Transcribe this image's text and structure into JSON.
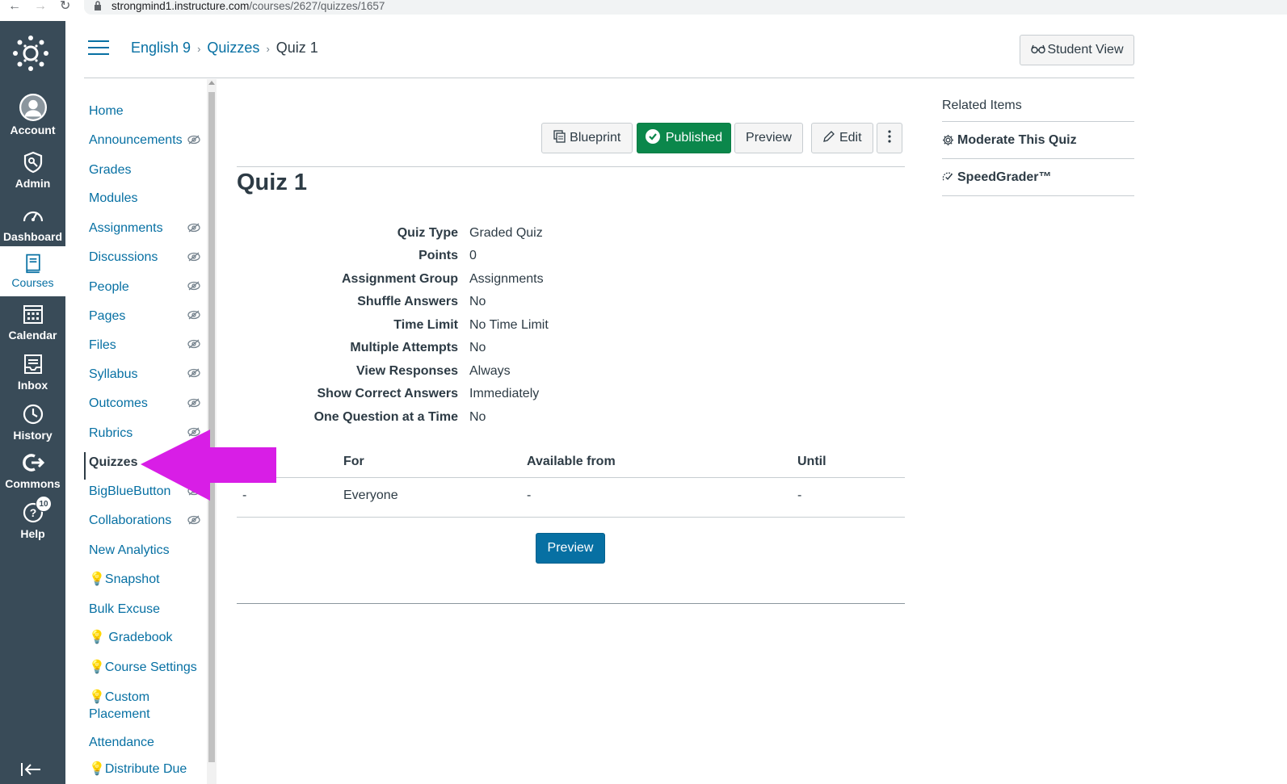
{
  "browser": {
    "url_host": "strongmind1.instructure.com",
    "url_path": "/courses/2627/quizzes/1657"
  },
  "global_nav": {
    "items": [
      {
        "label": "Account"
      },
      {
        "label": "Admin"
      },
      {
        "label": "Dashboard"
      },
      {
        "label": "Courses"
      },
      {
        "label": "Calendar"
      },
      {
        "label": "Inbox"
      },
      {
        "label": "History"
      },
      {
        "label": "Commons"
      },
      {
        "label": "Help",
        "badge": "10"
      }
    ]
  },
  "header": {
    "breadcrumb": [
      "English 9",
      "Quizzes",
      "Quiz 1"
    ],
    "student_view": "Student View"
  },
  "course_nav": {
    "items": [
      {
        "label": "Home"
      },
      {
        "label": "Announcements"
      },
      {
        "label": "Grades"
      },
      {
        "label": "Modules"
      },
      {
        "label": "Assignments"
      },
      {
        "label": "Discussions"
      },
      {
        "label": "People"
      },
      {
        "label": "Pages"
      },
      {
        "label": "Files"
      },
      {
        "label": "Syllabus"
      },
      {
        "label": "Outcomes"
      },
      {
        "label": "Rubrics"
      },
      {
        "label": "Quizzes"
      },
      {
        "label": "BigBlueButton"
      },
      {
        "label": "Collaborations"
      },
      {
        "label": "New Analytics"
      },
      {
        "label": "Snapshot"
      },
      {
        "label": "Bulk Excuse"
      },
      {
        "label": "Gradebook"
      },
      {
        "label": "Course Settings"
      },
      {
        "label": "Custom Placement"
      },
      {
        "label": "Attendance"
      },
      {
        "label": "Distribute Due"
      }
    ]
  },
  "toolbar": {
    "blueprint": "Blueprint",
    "published": "Published",
    "preview": "Preview",
    "edit": "Edit"
  },
  "quiz": {
    "title": "Quiz 1",
    "details": [
      {
        "label": "Quiz Type",
        "value": "Graded Quiz"
      },
      {
        "label": "Points",
        "value": "0"
      },
      {
        "label": "Assignment Group",
        "value": "Assignments"
      },
      {
        "label": "Shuffle Answers",
        "value": "No"
      },
      {
        "label": "Time Limit",
        "value": "No Time Limit"
      },
      {
        "label": "Multiple Attempts",
        "value": "No"
      },
      {
        "label": "View Responses",
        "value": "Always"
      },
      {
        "label": "Show Correct Answers",
        "value": "Immediately"
      },
      {
        "label": "One Question at a Time",
        "value": "No"
      }
    ],
    "due_table": {
      "headers": [
        "For",
        "Available from",
        "Until"
      ],
      "row": [
        "-",
        "Everyone",
        "-",
        "-"
      ]
    },
    "preview_button": "Preview"
  },
  "related": {
    "title": "Related Items",
    "items": [
      {
        "label": "Moderate This Quiz"
      },
      {
        "label": "SpeedGrader™"
      }
    ]
  },
  "colors": {
    "nav_bg": "#394b58",
    "link": "#0770a3",
    "published": "#0b874b",
    "arrow": "#d81ee6"
  }
}
